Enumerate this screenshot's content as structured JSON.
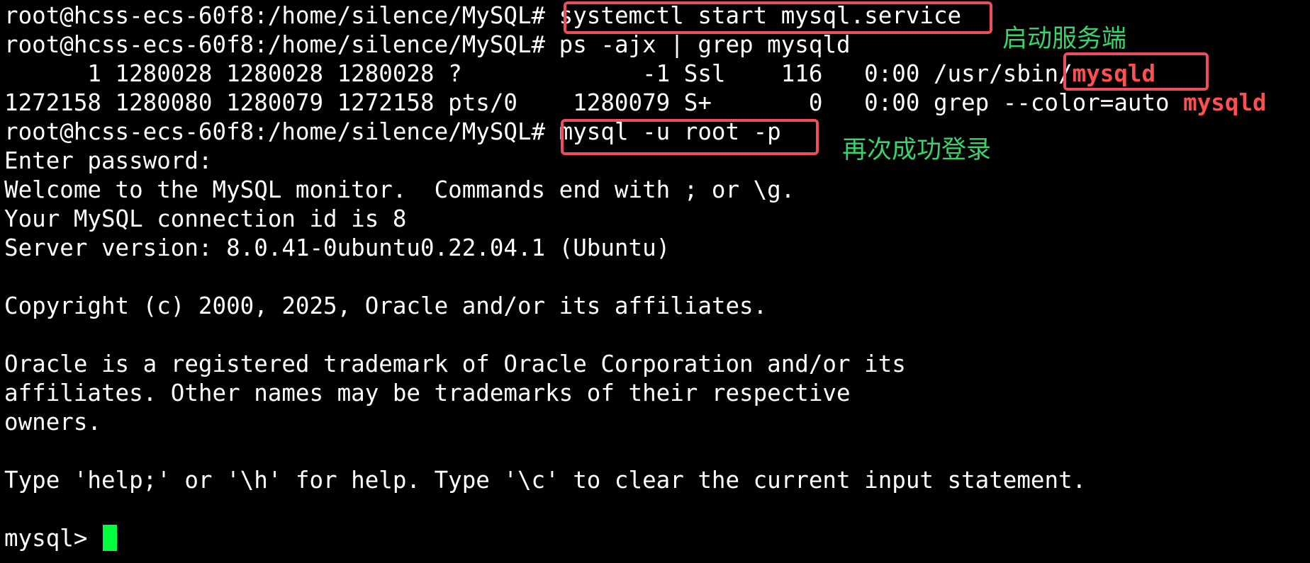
{
  "terminal": {
    "lines": [
      {
        "prompt": "root@hcss-ecs-60f8:/home/silence/MySQL# ",
        "command": "systemctl start mysql.service"
      },
      {
        "prompt": "root@hcss-ecs-60f8:/home/silence/MySQL# ",
        "command": "ps -ajx | grep mysqld"
      },
      {
        "text": "      1 1280028 1280028 1280028 ?             -1 Ssl    116   0:00 /usr/sbin/",
        "highlight": "mysqld"
      },
      {
        "text": "1272158 1280080 1280079 1272158 pts/0    1280079 S+       0   0:00 grep --color=auto ",
        "highlight": "mysqld"
      },
      {
        "prompt": "root@hcss-ecs-60f8:/home/silence/MySQL# ",
        "command": "mysql -u root -p"
      },
      {
        "text": "Enter password:"
      },
      {
        "text": "Welcome to the MySQL monitor.  Commands end with ; or \\g."
      },
      {
        "text": "Your MySQL connection id is 8"
      },
      {
        "text": "Server version: 8.0.41-0ubuntu0.22.04.1 (Ubuntu)"
      },
      {
        "text": ""
      },
      {
        "text": "Copyright (c) 2000, 2025, Oracle and/or its affiliates."
      },
      {
        "text": ""
      },
      {
        "text": "Oracle is a registered trademark of Oracle Corporation and/or its"
      },
      {
        "text": "affiliates. Other names may be trademarks of their respective"
      },
      {
        "text": "owners."
      },
      {
        "text": ""
      },
      {
        "text": "Type 'help;' or '\\h' for help. Type '\\c' to clear the current input statement."
      },
      {
        "text": ""
      },
      {
        "prompt": "mysql> "
      }
    ]
  },
  "annotations": {
    "start_server": "启动服务端",
    "login_again": "再次成功登录"
  },
  "colors": {
    "background": "#000000",
    "text": "#ffffff",
    "grep_match": "#ff4f4f",
    "annotation_box": "#ee4d5e",
    "annotation_text": "#3ad36a",
    "cursor": "#00ff3c"
  }
}
